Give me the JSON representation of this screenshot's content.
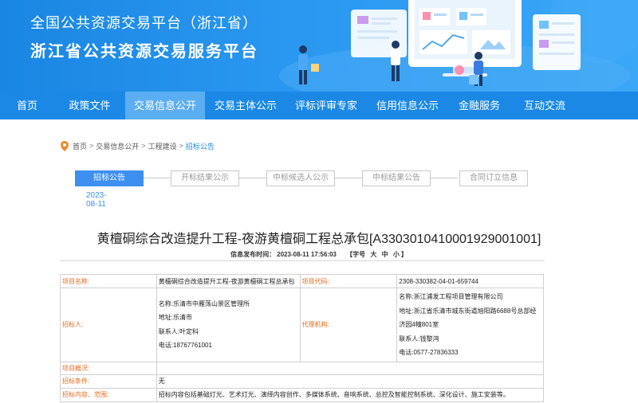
{
  "banner": {
    "title_line1": "全国公共资源交易平台（浙江省）",
    "title_line2": "浙江省公共资源交易服务平台"
  },
  "nav": {
    "items": [
      {
        "label": "首页"
      },
      {
        "label": "政策文件"
      },
      {
        "label": "交易信息公开",
        "active": true
      },
      {
        "label": "交易主体公示"
      },
      {
        "label": "评标评审专家"
      },
      {
        "label": "信用信息公示"
      },
      {
        "label": "金融服务"
      },
      {
        "label": "互动交流"
      }
    ]
  },
  "breadcrumb": {
    "items": [
      "首页",
      "交易信息公开",
      "工程建设"
    ],
    "separator": ">",
    "current": "招标公告"
  },
  "steps": {
    "items": [
      "招标公告",
      "开标结果公示",
      "中标候选人公示",
      "中标结果公告",
      "合同订立信息"
    ],
    "active_index": 0,
    "date": "2023-08-11"
  },
  "document": {
    "title": "黄檀硐综合改造提升工程-夜游黄檀硐工程总承包[A3303010410001929001001]",
    "publish_label": "信息发布时间：",
    "publish_time": "2023-08-11 17:56:03",
    "font_label": "【字号",
    "font_big": "大",
    "font_mid": "中",
    "font_small": "小",
    "font_close": "】"
  },
  "table": {
    "project_name_label": "项目名称:",
    "project_name": "黄檀硐综合改造提升工程-夜游黄檀硐工程总承包",
    "project_code_label": "项目代码:",
    "project_code": "2308-330382-04-01-659744",
    "tenderer_label": "招标人:",
    "tenderer": {
      "name": "名称:乐清市中雁荡山景区管理所",
      "address": "地址:乐清市",
      "contact": "联系人:叶定科",
      "phone": "电话:18767761001"
    },
    "agency_label": "代理机构:",
    "agency": {
      "name": "名称:浙江浦发工程项目管理有限公司",
      "address": "地址:浙江省乐清市城东街道旭阳路6688号总部经济园4幢801室",
      "contact": "联系人:钱黎鸿",
      "phone": "电话:0577-27836333"
    },
    "overview_label": "项目概况:",
    "overview": "",
    "conditions_label": "招标条件:",
    "conditions": "无",
    "scope_label": "招标内容、范围:",
    "scope": "招标内容包括基础灯光、艺术灯光、演绎内容创作、多媒体系统、音响系统、总控及智能控制系统、深化设计、施工安装等。"
  },
  "colors": {
    "nav_bg": "#1b88e6",
    "nav_active": "#5caef2",
    "step_active": "#3d8ff0",
    "label_orange": "#e46b1e",
    "link_blue": "#1b88e6"
  }
}
